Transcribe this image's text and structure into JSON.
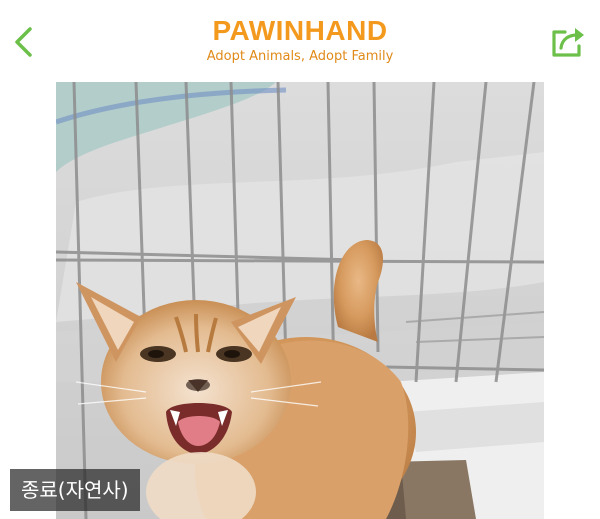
{
  "header": {
    "brand_title": "PAWINHAND",
    "brand_subtitle": "Adopt Animals, Adopt Family"
  },
  "icons": {
    "back": "chevron-left-icon",
    "share": "share-icon"
  },
  "photo": {
    "caption": "종료(자연사)"
  },
  "colors": {
    "brand_orange": "#f39a1e",
    "accent_green": "#6cc04a"
  }
}
